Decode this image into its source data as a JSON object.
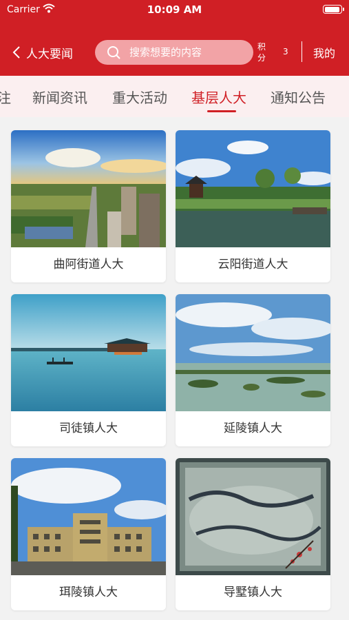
{
  "status_bar": {
    "carrier": "Carrier",
    "time": "10:09 AM"
  },
  "nav": {
    "back_label": "人大要闻",
    "search_placeholder": "搜索想要的内容",
    "points_label": "积分",
    "points_value": "3",
    "mine_label": "我的"
  },
  "tabs": [
    {
      "label": "注"
    },
    {
      "label": "新闻资讯"
    },
    {
      "label": "重大活动"
    },
    {
      "label": "基层人大",
      "active": true
    },
    {
      "label": "通知公告"
    }
  ],
  "cards": [
    {
      "label": "曲阿街道人大",
      "image": "aerial-city-photo"
    },
    {
      "label": "云阳街道人大",
      "image": "pavilion-lake-photo"
    },
    {
      "label": "司徒镇人大",
      "image": "lake-boat-photo"
    },
    {
      "label": "延陵镇人大",
      "image": "wetland-photo"
    },
    {
      "label": "珥陵镇人大",
      "image": "building-photo"
    },
    {
      "label": "导墅镇人大",
      "image": "calligraphy-stone-photo"
    }
  ],
  "colors": {
    "brand_red": "#d01f25",
    "tab_background": "#fbeff0",
    "search_background": "#f2a3a6"
  }
}
